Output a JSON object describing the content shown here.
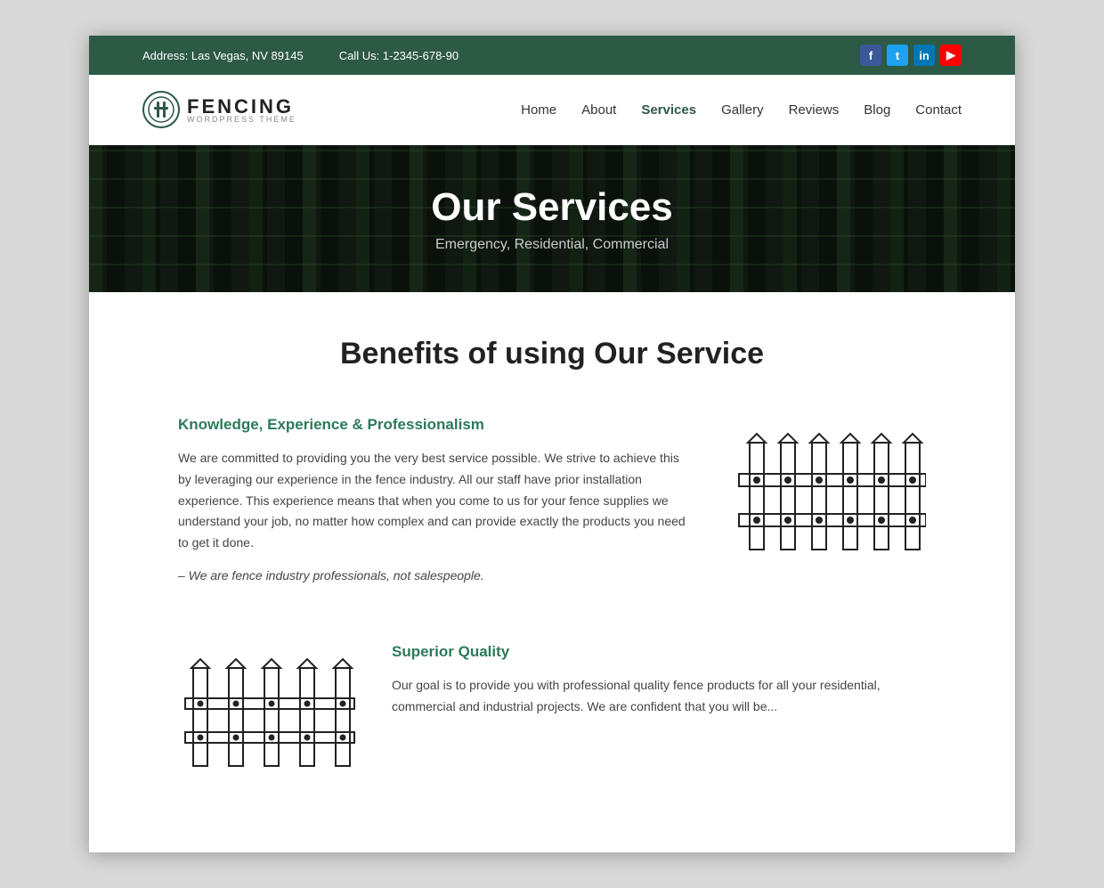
{
  "topbar": {
    "address_label": "Address: Las Vegas, NV 89145",
    "phone_label": "Call Us: 1-2345-678-90"
  },
  "social": [
    {
      "id": "fb",
      "label": "f",
      "name": "facebook-icon"
    },
    {
      "id": "tw",
      "label": "t",
      "name": "twitter-icon"
    },
    {
      "id": "li",
      "label": "in",
      "name": "linkedin-icon"
    },
    {
      "id": "yt",
      "label": "▶",
      "name": "youtube-icon"
    }
  ],
  "header": {
    "logo_text": "FENCING",
    "logo_sub": "WORDPRESS THEME"
  },
  "nav": {
    "items": [
      {
        "label": "Home",
        "active": false
      },
      {
        "label": "About",
        "active": false
      },
      {
        "label": "Services",
        "active": true
      },
      {
        "label": "Gallery",
        "active": false
      },
      {
        "label": "Reviews",
        "active": false
      },
      {
        "label": "Blog",
        "active": false
      },
      {
        "label": "Contact",
        "active": false
      }
    ]
  },
  "hero": {
    "title": "Our Services",
    "subtitle": "Emergency, Residential, Commercial"
  },
  "main": {
    "section_title": "Benefits of using Our Service",
    "benefit1": {
      "heading": "Knowledge, Experience & Professionalism",
      "body": "We are committed to providing you the very best service possible. We strive to achieve this by leveraging our experience in the fence industry. All our staff have prior installation experience. This experience means that when you come to us for your fence supplies we understand your job, no matter how complex and can provide exactly the products you need to get it done.",
      "quote": "– We are fence industry professionals, not salespeople."
    },
    "benefit2": {
      "heading": "Superior Quality",
      "body": "Our goal is to provide you with professional quality fence products for all your residential, commercial and industrial projects. We are confident that you will be..."
    }
  }
}
